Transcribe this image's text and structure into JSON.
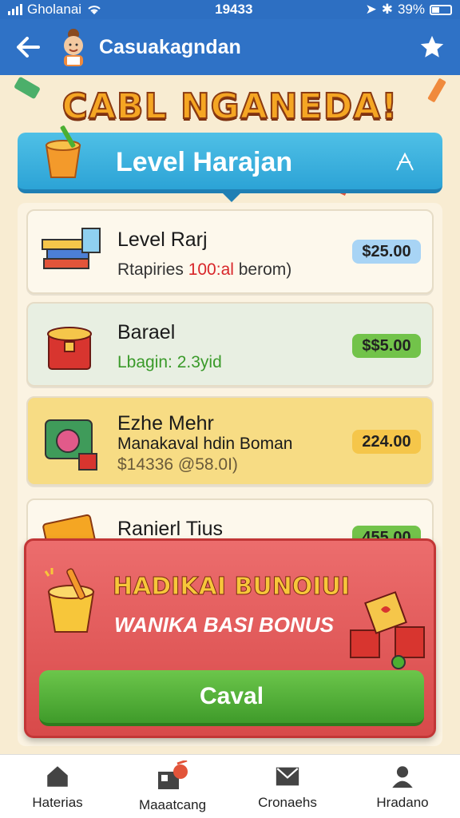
{
  "status_bar": {
    "carrier": "Gholanai",
    "time": "19433",
    "battery": "39%"
  },
  "app_bar": {
    "title": "Casuakagndan"
  },
  "headline": "CABL NGANEDA!",
  "level_banner": {
    "title": "Level Harajan"
  },
  "cards": [
    {
      "name": "Level Rarj",
      "sub_prefix": "Rtapiries ",
      "sub_highlight": "100:al",
      "sub_suffix": " berom)",
      "price": "$25.00",
      "price_color": "#a8d4f5"
    },
    {
      "name": "Barael",
      "sub": "Lbagin: 2.3yid",
      "price": "$$5.00",
      "price_color": "#72c34a"
    },
    {
      "name": "Ezhe Mehr",
      "sub": "Manakaval hdin Boman",
      "sub2": "$14336 @58.0I)",
      "price": "224.00",
      "price_color": "#f5c64a"
    },
    {
      "name": "Ranierl Tius",
      "price": "455.00",
      "price_color": "#72c34a"
    }
  ],
  "bonus": {
    "title": "HADIKAI BUNOIUI",
    "subtitle": "WANIKA BASI BONUS",
    "button": "Caval"
  },
  "nav": [
    {
      "label": "Haterias",
      "icon": "home-icon"
    },
    {
      "label": "Maaatcang",
      "icon": "shop-icon"
    },
    {
      "label": "Cronaehs",
      "icon": "mail-icon"
    },
    {
      "label": "Hradano",
      "icon": "user-icon"
    }
  ],
  "colors": {
    "primary": "#2f72c6",
    "accent_green": "#4caf32",
    "bonus_red": "#e05555"
  }
}
